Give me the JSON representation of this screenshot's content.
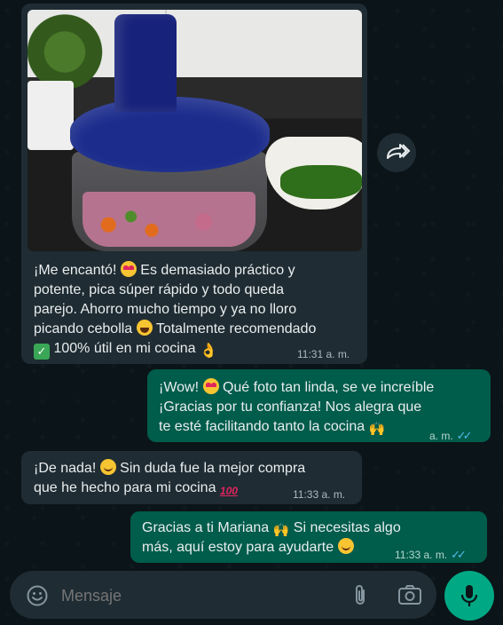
{
  "messages": [
    {
      "direction": "incoming",
      "has_photo": true,
      "lines": [
        "¡Me encantó!",
        "Es demasiado práctico y",
        "potente, pica súper rápido y todo queda",
        "parejo. Ahorro mucho tiempo y ya no lloro",
        "picando cebolla",
        "Totalmente recomendado",
        "100% útil en mi cocina"
      ],
      "time": "11:31 a. m."
    },
    {
      "direction": "outgoing",
      "lines": [
        "¡Wow!",
        "Qué foto tan linda, se ve increíble",
        "¡Gracias por tu confianza! Nos alegra que",
        "te esté facilitando tanto la cocina"
      ],
      "time": "a. m.",
      "status": "read"
    },
    {
      "direction": "incoming",
      "lines": [
        "¡De nada!",
        "Sin duda fue la mejor compra",
        "que he hecho para mi cocina"
      ],
      "time": "11:33 a. m."
    },
    {
      "direction": "outgoing",
      "lines": [
        "Gracias a ti Mariana",
        "Si necesitas algo",
        "más, aquí estoy para ayudarte"
      ],
      "time": "11:33 a. m.",
      "status": "read"
    }
  ],
  "composer": {
    "placeholder": "Mensaje"
  },
  "icons": {
    "forward": "forward-icon",
    "emoji": "emoji-icon",
    "attach": "paperclip-icon",
    "camera": "camera-icon",
    "mic": "microphone-icon",
    "read_ticks": "double-check-icon"
  },
  "colors": {
    "background": "#0b1418",
    "incoming_bubble": "#1f2c33",
    "outgoing_bubble": "#005c4b",
    "read_ticks": "#53bdeb",
    "mic_button": "#00a884"
  }
}
